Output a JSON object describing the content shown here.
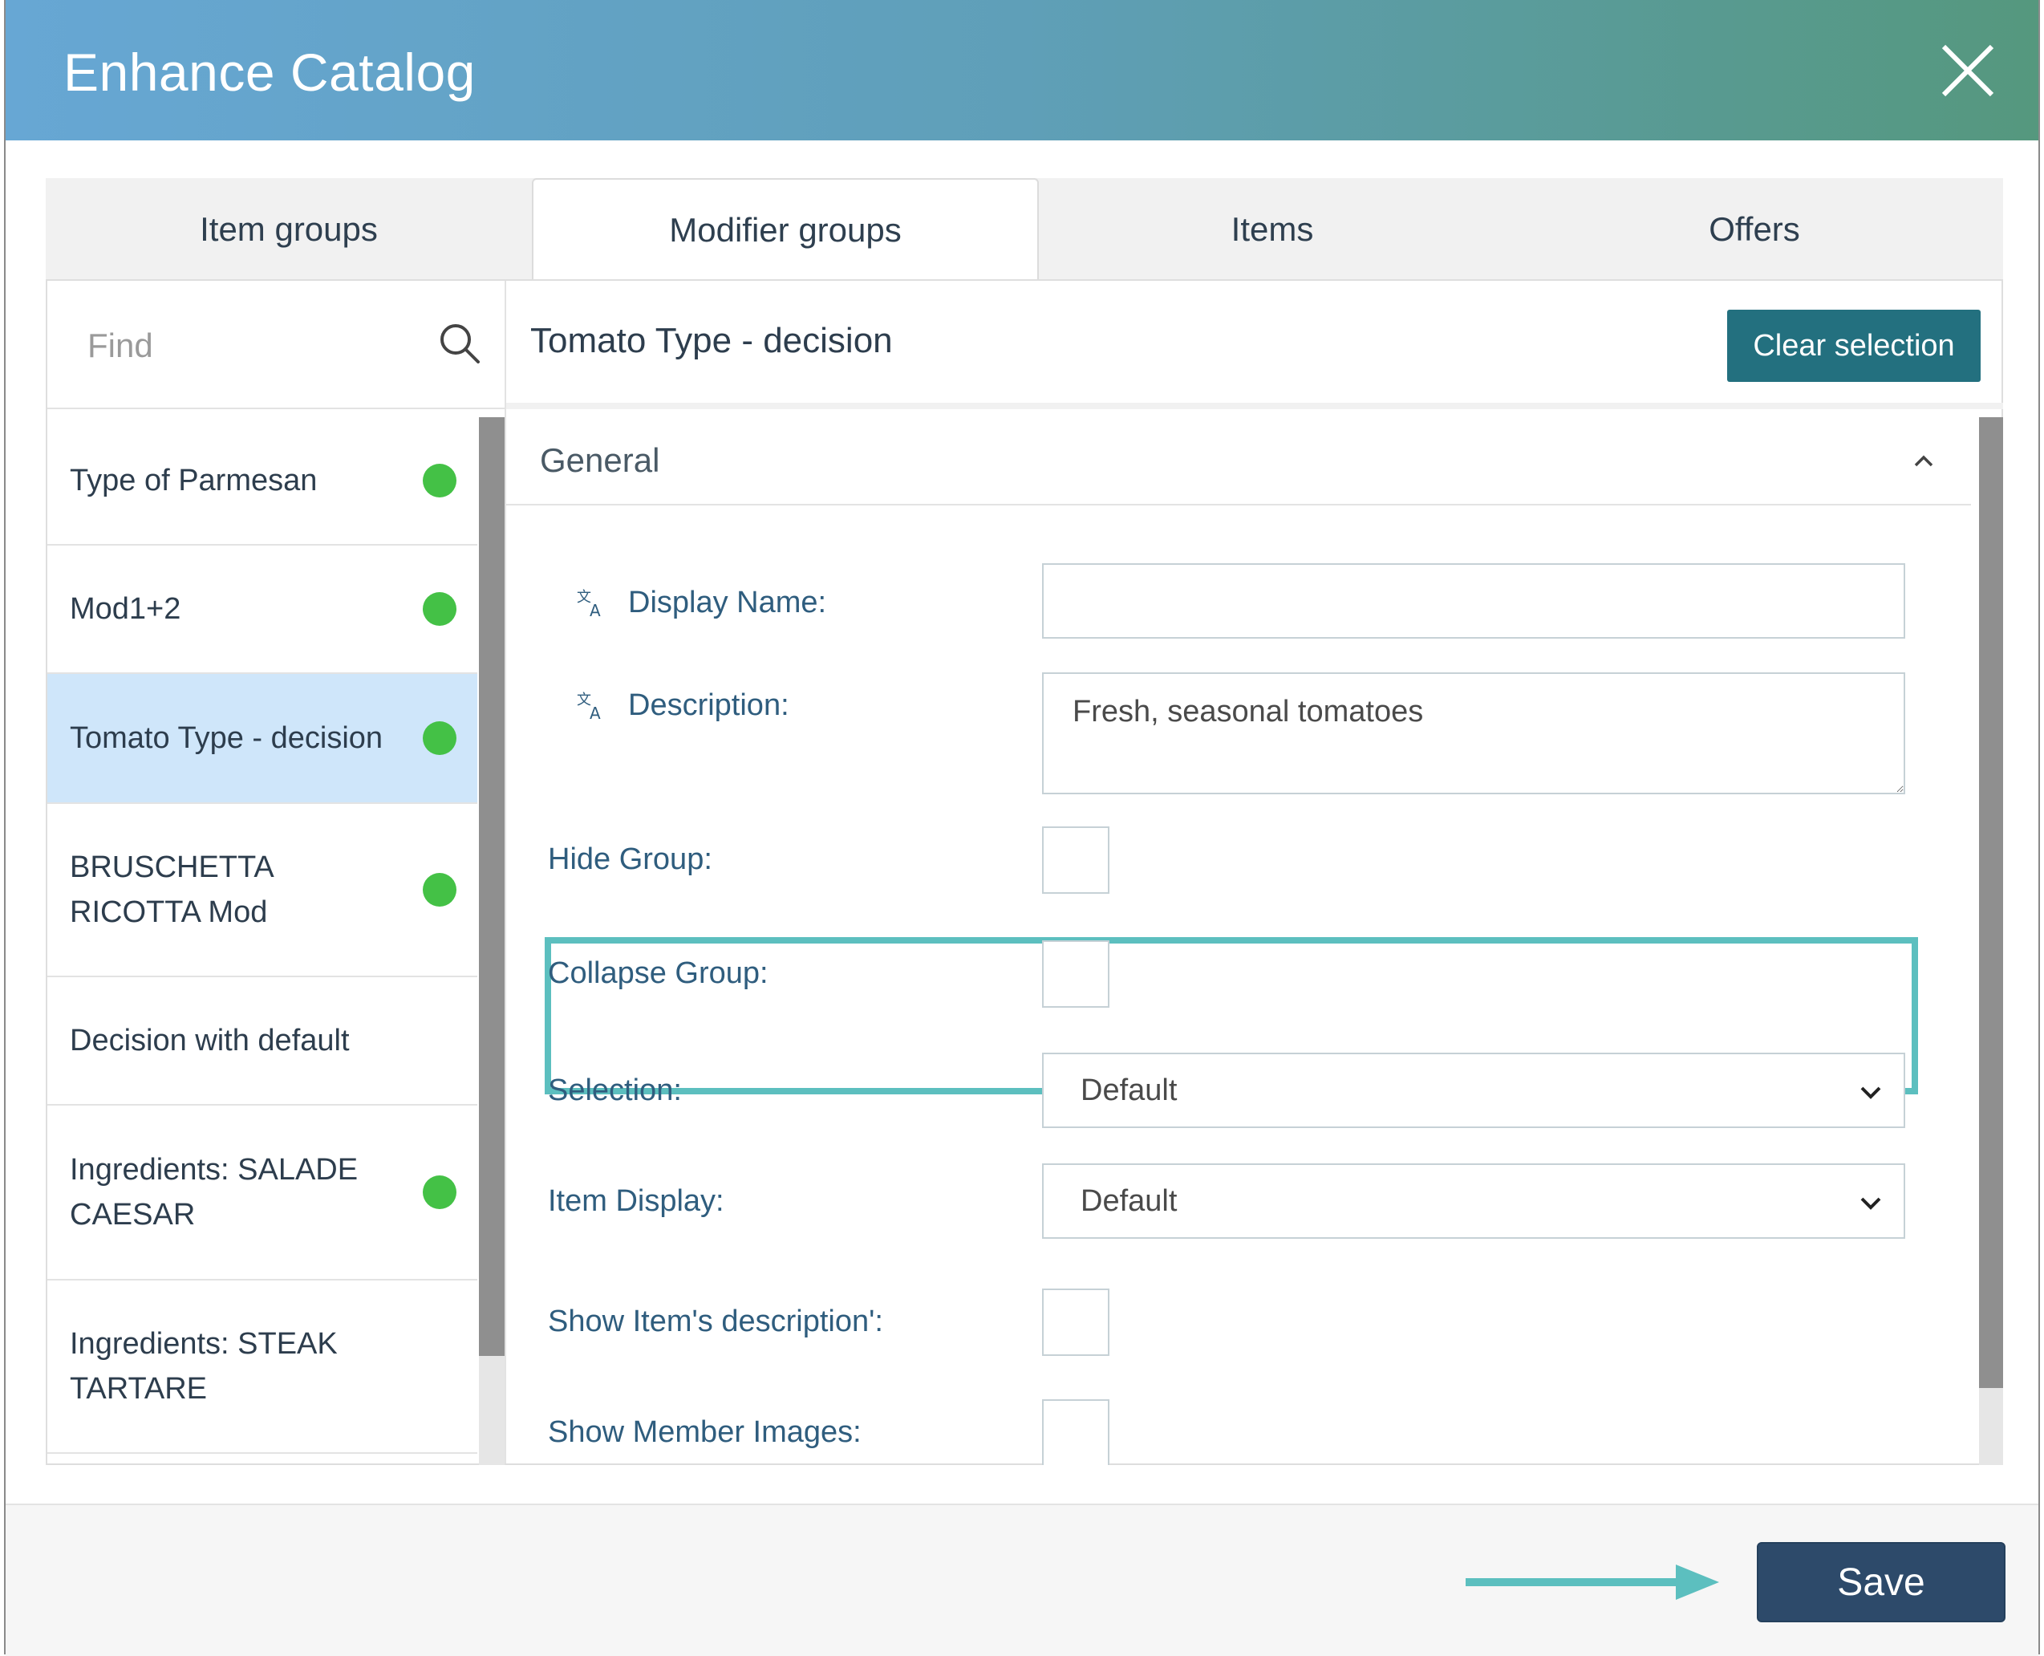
{
  "dialog": {
    "title": "Enhance Catalog"
  },
  "tabs": [
    {
      "label": "Item groups"
    },
    {
      "label": "Modifier groups",
      "active": true
    },
    {
      "label": "Items"
    },
    {
      "label": "Offers"
    }
  ],
  "search": {
    "placeholder": "Find"
  },
  "list": [
    {
      "label": "Type of Parmesan",
      "status": "active"
    },
    {
      "label": "Mod1+2",
      "status": "active"
    },
    {
      "label": "Tomato Type - decision",
      "status": "active",
      "selected": true
    },
    {
      "label": "BRUSCHETTA RICOTTA Mod",
      "status": "active"
    },
    {
      "label": "Decision with default",
      "status": "none"
    },
    {
      "label": "Ingredients: SALADE CAESAR",
      "status": "active"
    },
    {
      "label": "Ingredients: STEAK TARTARE",
      "status": "none"
    }
  ],
  "detail": {
    "title": "Tomato Type - decision",
    "clear_label": "Clear selection",
    "section_label": "General",
    "fields": {
      "display_name": {
        "label": "Display Name:",
        "value": ""
      },
      "description": {
        "label": "Description:",
        "value": "Fresh, seasonal tomatoes"
      },
      "hide_group": {
        "label": "Hide Group:",
        "checked": false
      },
      "collapse_group": {
        "label": "Collapse Group:",
        "checked": false
      },
      "selection": {
        "label": "Selection:",
        "value": "Default"
      },
      "item_display": {
        "label": "Item Display:",
        "value": "Default"
      },
      "show_item_description": {
        "label": "Show Item's description':",
        "checked": false
      },
      "show_member_images": {
        "label": "Show Member Images:",
        "checked": false
      }
    }
  },
  "footer": {
    "save_label": "Save"
  },
  "colors": {
    "header_start": "#67a7d4",
    "header_end": "#55987e",
    "status_dot": "#44c146",
    "clear_button": "#23707f",
    "save_button": "#2d4a6a",
    "highlight": "#5cbfbf",
    "selected_row": "#cfe6fa"
  }
}
